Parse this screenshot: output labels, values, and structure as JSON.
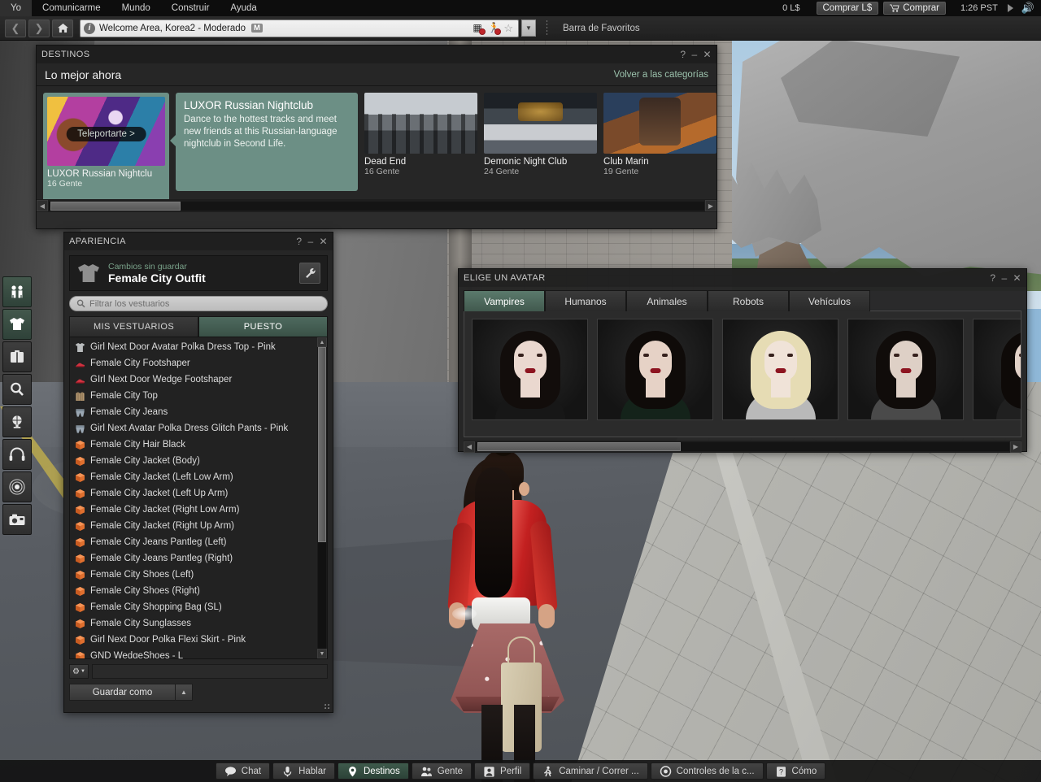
{
  "menu": {
    "items": [
      "Yo",
      "Comunicarme",
      "Mundo",
      "Construir",
      "Ayuda"
    ],
    "balance": "0 L$",
    "buy_lindens": "Comprar L$",
    "buy": "Comprar",
    "clock": "1:26 PST"
  },
  "navbar": {
    "location": "Welcome Area, Korea2 - Moderado",
    "maturity_badge": "M",
    "favorites_label": "Barra de Favoritos",
    "back_icon": "chevron-left-icon",
    "forward_icon": "chevron-right-icon",
    "home_icon": "home-icon",
    "info_icon": "info-icon",
    "icons": [
      "no-build-icon",
      "no-run-icon",
      "favorite-star-icon",
      "dropdown-icon"
    ]
  },
  "toolstrip": {
    "items": [
      {
        "name": "people-icon",
        "active": true
      },
      {
        "name": "appearance-shirt-icon",
        "active": true
      },
      {
        "name": "inventory-briefcase-icon",
        "active": false
      },
      {
        "name": "search-icon",
        "active": false
      },
      {
        "name": "world-map-globe-icon",
        "active": false
      },
      {
        "name": "headphones-voice-icon",
        "active": false
      },
      {
        "name": "minimap-radar-icon",
        "active": false
      },
      {
        "name": "snapshot-camera-icon",
        "active": false
      }
    ]
  },
  "destinos": {
    "title": "DESTINOS",
    "heading": "Lo mejor ahora",
    "back_link": "Volver a las categorías",
    "help_icon": "help-icon",
    "minimize_icon": "minimize-icon",
    "close_icon": "close-icon",
    "teleport_label": "Teleportarte >",
    "cards": [
      {
        "name": "LUXOR Russian Nightclu",
        "people": "16 Gente",
        "selected": true,
        "art": "tb-luxor"
      },
      {
        "name": "Dead End",
        "people": "16 Gente",
        "selected": false,
        "art": "tb-dead"
      },
      {
        "name": "Demonic Night Club",
        "people": "24 Gente",
        "selected": false,
        "art": "tb-demonic"
      },
      {
        "name": "Club Marin",
        "people": "19 Gente",
        "selected": false,
        "art": "tb-marina"
      }
    ],
    "info": {
      "title": "LUXOR Russian Nightclub",
      "description": "Dance to the hottest tracks and meet new friends at this Russian-language nightclub in Second Life."
    },
    "scroll": {
      "left_arrow": "scroll-left-arrow-icon",
      "right_arrow": "scroll-right-arrow-icon"
    }
  },
  "apariencia": {
    "title": "APARIENCIA",
    "unsaved": "Cambios sin guardar",
    "outfit_name": "Female City Outfit",
    "shirt_icon": "tshirt-icon",
    "wrench_icon": "wrench-icon",
    "search_placeholder": "Filtrar los vestuarios",
    "search_icon": "search-icon",
    "tabs": [
      {
        "label": "MIS VESTUARIOS",
        "active": false
      },
      {
        "label": "PUESTO",
        "active": true
      }
    ],
    "items": [
      {
        "label": "Girl Next Door Avatar Polka Dress Top - Pink",
        "icon": "shirt-item-icon"
      },
      {
        "label": "Female City Footshaper",
        "icon": "shoe-item-icon"
      },
      {
        "label": "GIrl Next Door Wedge Footshaper",
        "icon": "shoe-item-icon"
      },
      {
        "label": "Female City Top",
        "icon": "jacket-item-icon"
      },
      {
        "label": "Female City Jeans",
        "icon": "pants-item-icon"
      },
      {
        "label": "Girl Next  Avatar Polka Dress Glitch Pants - Pink",
        "icon": "pants-item-icon"
      },
      {
        "label": "Female City Hair Black",
        "icon": "object-box-icon"
      },
      {
        "label": "Female City Jacket (Body)",
        "icon": "object-box-icon"
      },
      {
        "label": "Female City Jacket (Left Low Arm)",
        "icon": "object-box-icon"
      },
      {
        "label": "Female City Jacket (Left Up Arm)",
        "icon": "object-box-icon"
      },
      {
        "label": "Female City Jacket (Right Low Arm)",
        "icon": "object-box-icon"
      },
      {
        "label": "Female City Jacket (Right Up Arm)",
        "icon": "object-box-icon"
      },
      {
        "label": "Female City Jeans Pantleg (Left)",
        "icon": "object-box-icon"
      },
      {
        "label": "Female City Jeans Pantleg (Right)",
        "icon": "object-box-icon"
      },
      {
        "label": "Female City Shoes (Left)",
        "icon": "object-box-icon"
      },
      {
        "label": "Female City Shoes (Right)",
        "icon": "object-box-icon"
      },
      {
        "label": "Female City Shopping Bag (SL)",
        "icon": "object-box-icon"
      },
      {
        "label": "Female City Sunglasses",
        "icon": "object-box-icon"
      },
      {
        "label": "Girl Next Door Polka Flexi Skirt - Pink",
        "icon": "object-box-icon"
      },
      {
        "label": "GND WedgeShoes - L",
        "icon": "object-box-icon"
      }
    ],
    "gear_icon": "gear-dropdown-icon",
    "save_as": "Guardar como",
    "save_arrow_icon": "caret-up-icon"
  },
  "avatar_chooser": {
    "title": "ELIGE UN AVATAR",
    "help_icon": "help-icon",
    "minimize_icon": "minimize-icon",
    "close_icon": "close-icon",
    "tabs": [
      {
        "label": "Vampires",
        "active": true
      },
      {
        "label": "Humanos",
        "active": false
      },
      {
        "label": "Animales",
        "active": false
      },
      {
        "label": "Robots",
        "active": false
      },
      {
        "label": "Vehículos",
        "active": false
      }
    ],
    "thumbs": [
      {
        "name": "vampire-female-long-dark-hair",
        "hair": "#120d0b",
        "skin": "#ead8cf",
        "body": "#171717"
      },
      {
        "name": "vampire-female-bloody-lips",
        "hair": "#0f0b09",
        "skin": "#e6d2c6",
        "body": "#14231a"
      },
      {
        "name": "vampire-female-blonde",
        "hair": "#e6dcb4",
        "skin": "#f0e3d8",
        "body": "#b9b9b9"
      },
      {
        "name": "vampire-male-long-hair",
        "hair": "#100c0a",
        "skin": "#ded0c6",
        "body": "#4a4a4a"
      },
      {
        "name": "vampire-partial-thumb",
        "hair": "#0e0a08",
        "skin": "#e2d2c8",
        "body": "#202020"
      }
    ]
  },
  "bottombar": {
    "buttons": [
      {
        "label": "Chat",
        "icon": "chat-bubble-icon",
        "active": false
      },
      {
        "label": "Hablar",
        "icon": "microphone-icon",
        "active": false
      },
      {
        "label": "Destinos",
        "icon": "map-pin-icon",
        "active": true
      },
      {
        "label": "Gente",
        "icon": "people-icon",
        "active": false
      },
      {
        "label": "Perfil",
        "icon": "profile-card-icon",
        "active": false
      },
      {
        "label": "Caminar / Correr ...",
        "icon": "walk-run-icon",
        "active": false
      },
      {
        "label": "Controles de la c...",
        "icon": "camera-controls-icon",
        "active": false
      },
      {
        "label": "Cómo",
        "icon": "how-to-help-icon",
        "active": false
      }
    ]
  }
}
